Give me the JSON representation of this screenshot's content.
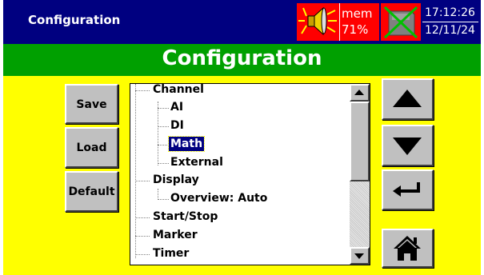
{
  "titlebar": {
    "app_title": "Configuration",
    "mem_label": "mem",
    "mem_percent": "71%",
    "time": "17:12:26",
    "date": "12/11/24",
    "icons": [
      "speaker-icon",
      "card-crossed-icon"
    ]
  },
  "header": {
    "title": "Configuration"
  },
  "buttons": {
    "save": "Save",
    "load": "Load",
    "default": "Default"
  },
  "tree": {
    "items": [
      {
        "label": "Channel",
        "level": 0
      },
      {
        "label": "AI",
        "level": 1
      },
      {
        "label": "DI",
        "level": 1
      },
      {
        "label": "Math",
        "level": 1,
        "selected": true
      },
      {
        "label": "External",
        "level": 1
      },
      {
        "label": "Display",
        "level": 0
      },
      {
        "label": "Overview: Auto",
        "level": 1
      },
      {
        "label": "Start/Stop",
        "level": 0
      },
      {
        "label": "Marker",
        "level": 0
      },
      {
        "label": "Timer",
        "level": 0
      }
    ]
  },
  "nav": {
    "icons": [
      "arrow-up-icon",
      "arrow-down-icon",
      "enter-icon",
      "home-icon"
    ]
  },
  "colors": {
    "titlebar": "#000080",
    "header": "#00a000",
    "body": "#ffff00",
    "alert": "#ff0000",
    "selection": "#000080"
  }
}
